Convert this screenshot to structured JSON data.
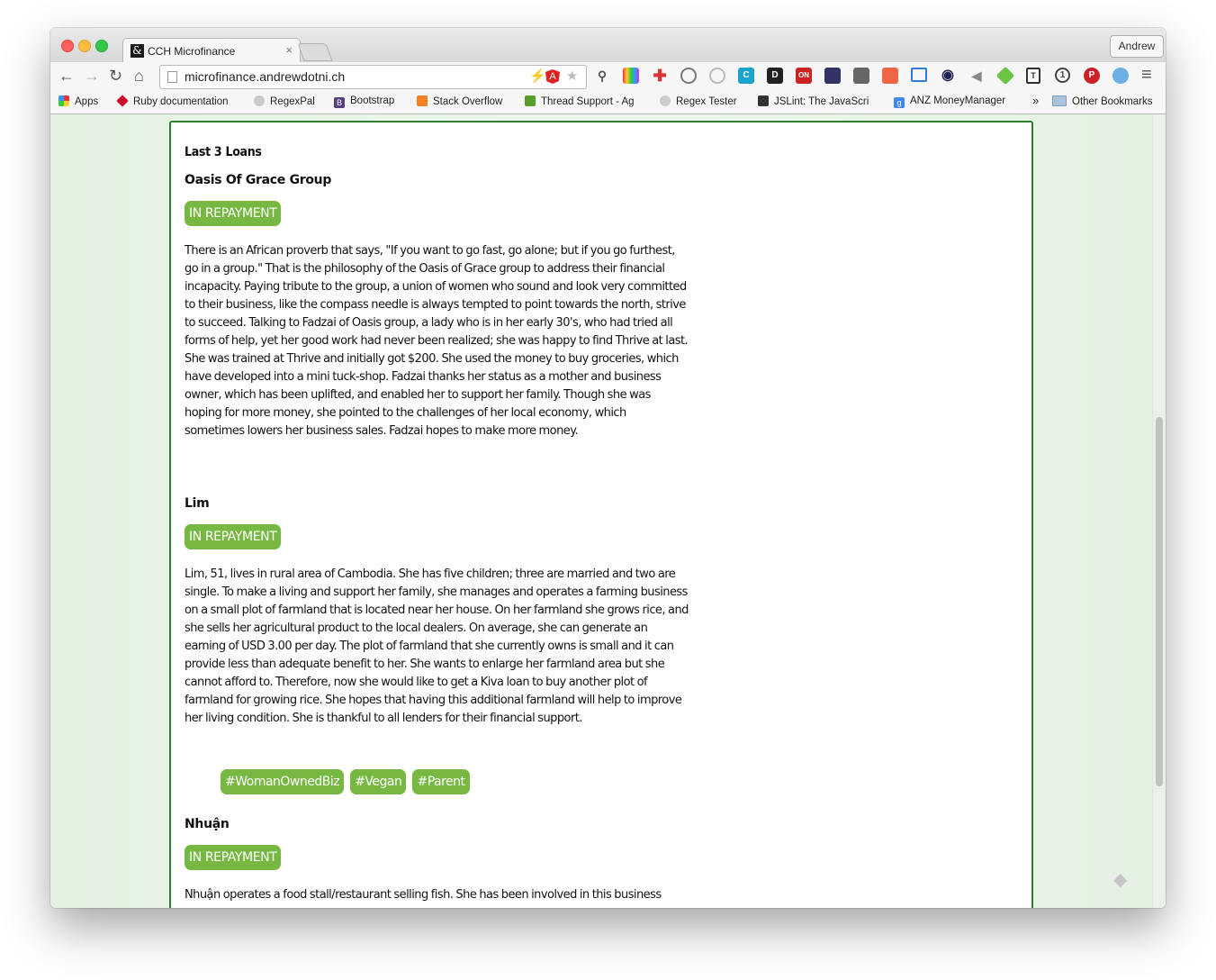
{
  "browser": {
    "tab_title": "CCH Microfinance",
    "tab_favicon": "&",
    "tab_close": "×",
    "profile_name": "Andrew",
    "url": "microfinance.andrewdotni.ch"
  },
  "icons": {
    "back": "←",
    "forward": "→",
    "reload": "↻",
    "home": "⌂",
    "star": "★",
    "bolt": "⚡",
    "menu": "≡",
    "more": "»"
  },
  "bookmarks": {
    "items": [
      {
        "label": "Apps",
        "color": "#e33"
      },
      {
        "label": "Ruby documentation",
        "color": "#c8102e"
      },
      {
        "label": "RegexPal",
        "color": "#999"
      },
      {
        "label": "Bootstrap",
        "color": "#563d7c"
      },
      {
        "label": "Stack Overflow",
        "color": "#f48024"
      },
      {
        "label": "Thread Support - Ag",
        "color": "#5a9e30"
      },
      {
        "label": "Regex Tester",
        "color": "#999"
      },
      {
        "label": "JSLint: The JavaScri",
        "color": "#333"
      },
      {
        "label": "ANZ MoneyManager",
        "color": "#4285f4"
      }
    ],
    "overflow": "»",
    "other": "Other Bookmarks"
  },
  "page": {
    "section_title": "Last 3 Loans",
    "loans": [
      {
        "name": "Oasis Of Grace Group",
        "status": "IN REPAYMENT",
        "description": "There is an African proverb that says, \"If you want to go fast, go alone; but if you go furthest, go in a group.\" That is the philosophy of the Oasis of Grace group to address their financial incapacity. Paying tribute to the group, a union of women who sound and look very committed to their business, like the compass needle is always tempted to point towards the north, strive to succeed. Talking to Fadzai of Oasis group, a lady who is in her early 30's, who had tried all forms of help, yet her good work had never been realized; she was happy to find Thrive at last. She was trained at Thrive and initially got $200. She used the money to buy groceries, which have developed into a mini tuck-shop. Fadzai thanks her status as a mother and business owner, which has been uplifted, and enabled her to support her family. Though she was hoping for more money, she pointed to the challenges of her local economy, which sometimes lowers her business sales. Fadzai hopes to make more money."
      },
      {
        "name": "Lim",
        "status": "IN REPAYMENT",
        "description": "Lim, 51, lives in rural area of Cambodia. She has five children; three are married and two are single. To make a living and support her family, she manages and operates a farming business on a small plot of farmland that is located near her house. On her farmland she grows rice, and she sells her agricultural product to the local dealers. On average, she can generate an earning of USD 3.00 per day. The plot of farmland that she currently owns is small and it can provide less than adequate benefit to her. She wants to enlarge her farmland area but she cannot afford to. Therefore, now she would like to get a Kiva loan to buy another plot of farmland for growing rice. She hopes that having this additional farmland will help to improve her living condition. She is thankful to all lenders for their financial support.",
        "tags": [
          "#WomanOwnedBiz",
          "#Vegan",
          "#Parent"
        ]
      },
      {
        "name": "Nhuận",
        "status": "IN REPAYMENT",
        "description": "Nhuận operates a food stall/restaurant selling fish. She has been involved in this business"
      }
    ]
  },
  "colors": {
    "accent_green": "#77b843",
    "card_border": "#2f7d2f",
    "page_bg": "#e4f2e2"
  }
}
